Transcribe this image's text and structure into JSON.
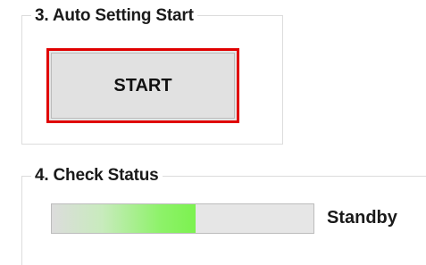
{
  "auto_setting": {
    "legend": "3. Auto Setting Start",
    "start_button_label": "START"
  },
  "check_status": {
    "legend": "4. Check Status",
    "progress_fraction": 0.55,
    "status_text": "Standby"
  },
  "colors": {
    "start_button_border": "#e00000",
    "progress_fill": "#7cf24f"
  }
}
